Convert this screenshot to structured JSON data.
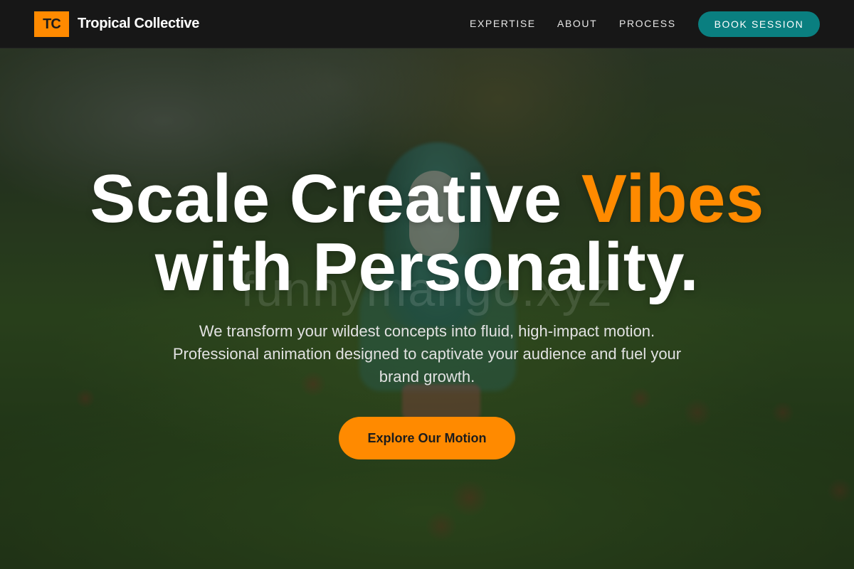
{
  "brand": {
    "logo_initials": "TC",
    "name": "Tropical Collective"
  },
  "nav": {
    "links": [
      "EXPERTISE",
      "ABOUT",
      "PROCESS"
    ],
    "cta_label": "BOOK SESSION"
  },
  "hero": {
    "headline_part1": "Scale Creative ",
    "headline_accent": "Vibes",
    "headline_line2": "with Personality.",
    "subtext": "We transform your wildest concepts into fluid, high-impact motion. Professional animation designed to captivate your audience and fuel your brand growth.",
    "cta_label": "Explore Our Motion",
    "watermark": "funnymango.xyz"
  },
  "colors": {
    "accent": "#ff8a00",
    "teal": "#0a7f80",
    "navbar_bg": "#171717"
  }
}
